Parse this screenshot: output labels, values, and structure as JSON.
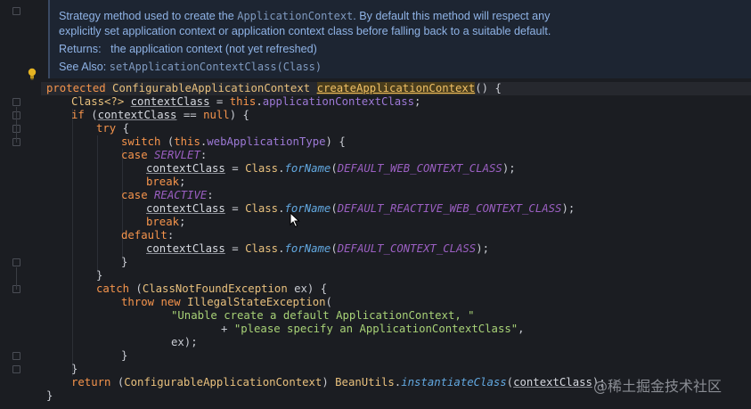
{
  "doc": {
    "line1_pre": "Strategy method used to create the ",
    "line1_code": "ApplicationContext",
    "line1_post": ". By default this method will respect any",
    "line2": "explicitly set application context or application context class before falling back to a suitable default.",
    "returns_label": "Returns:",
    "returns_text": "the application context (not yet refreshed)",
    "see_also_label": "See Also:",
    "see_also_link": "setApplicationContextClass(Class)"
  },
  "code": {
    "l1": {
      "kw": "protected",
      "type": "ConfigurableApplicationContext",
      "method": "createApplicationContext",
      "rest": "() {"
    },
    "l2": {
      "type": "Class<?>",
      "var": "contextClass",
      "eq": " = ",
      "kw": "this",
      "dot": ".",
      "field": "applicationContextClass",
      "semi": ";"
    },
    "l3": {
      "kw": "if",
      "open": " (",
      "var": "contextClass",
      "op": " == ",
      "kw2": "null",
      "close": ") {"
    },
    "l4": {
      "kw": "try",
      "rest": " {"
    },
    "l5": {
      "kw": "switch",
      "open": " (",
      "kw2": "this",
      "dot": ".",
      "field": "webApplicationType",
      "close": ") {"
    },
    "l6": {
      "kw": "case",
      "enum": "SERVLET",
      "colon": ":"
    },
    "l7": {
      "var": "contextClass",
      "eq": " = ",
      "cls": "Class",
      "dot": ".",
      "m": "forName",
      "open": "(",
      "const": "DEFAULT_WEB_CONTEXT_CLASS",
      "close": ");"
    },
    "l8": {
      "kw": "break",
      "semi": ";"
    },
    "l9": {
      "kw": "case",
      "enum": "REACTIVE",
      "colon": ":"
    },
    "l10": {
      "var": "contextClass",
      "eq": " = ",
      "cls": "Class",
      "dot": ".",
      "m": "forName",
      "open": "(",
      "const": "DEFAULT_REACTIVE_WEB_CONTEXT_CLASS",
      "close": ");"
    },
    "l11": {
      "kw": "break",
      "semi": ";"
    },
    "l12": {
      "kw": "default",
      "colon": ":"
    },
    "l13": {
      "var": "contextClass",
      "eq": " = ",
      "cls": "Class",
      "dot": ".",
      "m": "forName",
      "open": "(",
      "const": "DEFAULT_CONTEXT_CLASS",
      "close": ");"
    },
    "l14": {
      "text": "}"
    },
    "l15": {
      "text": "}"
    },
    "l16": {
      "kw": "catch",
      "open": " (",
      "cls": "ClassNotFoundException",
      "rest": " ex) {"
    },
    "l17": {
      "kw": "throw",
      "kw2": "new",
      "cls": "IllegalStateException",
      "rest": "("
    },
    "l18": {
      "str": "\"Unable create a default ApplicationContext, \""
    },
    "l19": {
      "op": "+ ",
      "str": "\"please specify an ApplicationContextClass\"",
      "rest": ","
    },
    "l20": {
      "text": "ex);"
    },
    "l21": {
      "text": "}"
    },
    "l22": {
      "text": "}"
    },
    "l23": {
      "kw": "return",
      "open": " (",
      "cls": "ConfigurableApplicationContext",
      "mid": ") ",
      "cls2": "BeanUtils",
      "dot": ".",
      "m": "instantiateClass",
      "popen": "(",
      "var": "contextClass",
      "close": ");"
    },
    "l24": {
      "text": "}"
    }
  },
  "watermark": "@稀土掘金技术社区",
  "icons": {
    "hint": "lightbulb-icon",
    "pointer": "mouse-pointer-icon"
  }
}
